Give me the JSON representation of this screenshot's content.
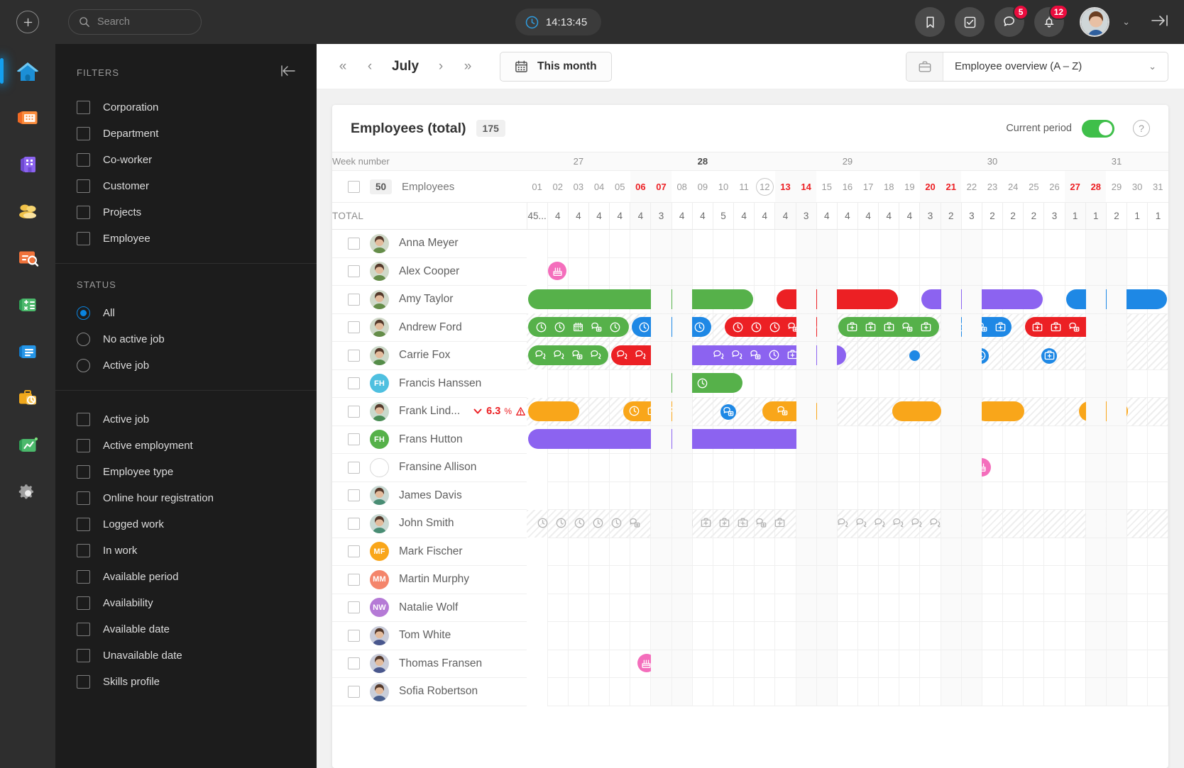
{
  "topbar": {
    "add_label": "+",
    "search_placeholder": "Search",
    "search_value": "",
    "clock_time": "14:13:45",
    "chat_badge": "5",
    "notification_badge": "12"
  },
  "rail": {
    "items": [
      {
        "name": "home",
        "label": "Home"
      },
      {
        "name": "planning",
        "label": "Planning"
      },
      {
        "name": "corporation",
        "label": "Corporation"
      },
      {
        "name": "co-workers",
        "label": "Co-workers"
      },
      {
        "name": "recruitment",
        "label": "Recruitment"
      },
      {
        "name": "calculation",
        "label": "Calculation"
      },
      {
        "name": "documents",
        "label": "Documents"
      },
      {
        "name": "time-registration",
        "label": "Time registration"
      },
      {
        "name": "analytics",
        "label": "Analytics"
      },
      {
        "name": "settings",
        "label": "Settings"
      }
    ]
  },
  "filters": {
    "title": "FILTERS",
    "checkboxes": [
      {
        "label": "Corporation",
        "checked": false
      },
      {
        "label": "Department",
        "checked": false
      },
      {
        "label": "Co-worker",
        "checked": false
      },
      {
        "label": "Customer",
        "checked": false
      },
      {
        "label": "Projects",
        "checked": false
      },
      {
        "label": "Employee",
        "checked": false
      }
    ],
    "status_title": "STATUS",
    "status_options": [
      {
        "label": "All",
        "selected": true
      },
      {
        "label": "No active job",
        "selected": false
      },
      {
        "label": "Active job",
        "selected": false
      }
    ],
    "more_checkboxes": [
      {
        "label": "Active job",
        "checked": false
      },
      {
        "label": "Active employment",
        "checked": false
      },
      {
        "label": "Employee type",
        "checked": false
      },
      {
        "label": "Online hour registration",
        "checked": false
      },
      {
        "label": "Logged work",
        "checked": false
      },
      {
        "label": "In work",
        "checked": false
      },
      {
        "label": "Available period",
        "checked": false
      },
      {
        "label": "Availability",
        "checked": false
      },
      {
        "label": "Available date",
        "checked": false
      },
      {
        "label": "Unavailable date",
        "checked": false
      },
      {
        "label": "Skills profile",
        "checked": false
      }
    ]
  },
  "toolbar": {
    "month": "July",
    "this_month_label": "This month",
    "view_select_value": "Employee overview (A – Z)"
  },
  "card": {
    "title": "Employees (total)",
    "count": "175",
    "current_period_label": "Current period",
    "current_period_on": true,
    "week_number_label": "Week number",
    "employees_count": "50",
    "employees_label": "Employees",
    "total_label": "TOTAL"
  },
  "calendar": {
    "weeks": [
      {
        "number": "27",
        "span": 5,
        "current": false
      },
      {
        "number": "28",
        "span": 7,
        "current": true
      },
      {
        "number": "29",
        "span": 7,
        "current": false
      },
      {
        "number": "30",
        "span": 7,
        "current": false
      },
      {
        "number": "31",
        "span": 5,
        "current": false
      }
    ],
    "days": [
      {
        "n": "01",
        "weekend": false,
        "today": false
      },
      {
        "n": "02",
        "weekend": false,
        "today": false
      },
      {
        "n": "03",
        "weekend": false,
        "today": false
      },
      {
        "n": "04",
        "weekend": false,
        "today": false
      },
      {
        "n": "05",
        "weekend": false,
        "today": false
      },
      {
        "n": "06",
        "weekend": true,
        "today": false
      },
      {
        "n": "07",
        "weekend": true,
        "today": false
      },
      {
        "n": "08",
        "weekend": false,
        "today": false
      },
      {
        "n": "09",
        "weekend": false,
        "today": false
      },
      {
        "n": "10",
        "weekend": false,
        "today": false
      },
      {
        "n": "11",
        "weekend": false,
        "today": false
      },
      {
        "n": "12",
        "weekend": false,
        "today": true
      },
      {
        "n": "13",
        "weekend": true,
        "today": false
      },
      {
        "n": "14",
        "weekend": true,
        "today": false
      },
      {
        "n": "15",
        "weekend": false,
        "today": false
      },
      {
        "n": "16",
        "weekend": false,
        "today": false
      },
      {
        "n": "17",
        "weekend": false,
        "today": false
      },
      {
        "n": "18",
        "weekend": false,
        "today": false
      },
      {
        "n": "19",
        "weekend": false,
        "today": false
      },
      {
        "n": "20",
        "weekend": true,
        "today": false
      },
      {
        "n": "21",
        "weekend": true,
        "today": false
      },
      {
        "n": "22",
        "weekend": false,
        "today": false
      },
      {
        "n": "23",
        "weekend": false,
        "today": false
      },
      {
        "n": "24",
        "weekend": false,
        "today": false
      },
      {
        "n": "25",
        "weekend": false,
        "today": false
      },
      {
        "n": "26",
        "weekend": false,
        "today": false
      },
      {
        "n": "27",
        "weekend": true,
        "today": false
      },
      {
        "n": "28",
        "weekend": true,
        "today": false
      },
      {
        "n": "29",
        "weekend": false,
        "today": false
      },
      {
        "n": "30",
        "weekend": false,
        "today": false
      },
      {
        "n": "31",
        "weekend": false,
        "today": false
      }
    ],
    "totals": [
      "45...",
      "4",
      "4",
      "4",
      "4",
      "4",
      "3",
      "4",
      "4",
      "5",
      "4",
      "4",
      "4",
      "3",
      "4",
      "4",
      "4",
      "4",
      "4",
      "3",
      "2",
      "3",
      "2",
      "2",
      "2",
      "3",
      "1",
      "1",
      "2",
      "1",
      "1"
    ]
  },
  "colors": {
    "green": "#56b14a",
    "red": "#ec2024",
    "purple": "#8c63f0",
    "blue": "#1e88e5",
    "orange": "#f9a61a",
    "pink": "#f46ebc",
    "teal": "#4fc0e0"
  },
  "employees": [
    {
      "name": "Anna Meyer",
      "avatar_type": "photo",
      "photo": "woman1",
      "bars": []
    },
    {
      "name": "Alex Cooper",
      "avatar_type": "photo",
      "photo": "man1",
      "bars": [
        {
          "kind": "pinkdot",
          "start": 1,
          "icon": "birthday-cake"
        }
      ]
    },
    {
      "name": "Amy Taylor",
      "avatar_type": "photo",
      "photo": "woman2",
      "bars": [
        {
          "kind": "bar",
          "color": "green",
          "start": 0,
          "end": 11,
          "icons": []
        },
        {
          "kind": "bar",
          "color": "red",
          "start": 12,
          "end": 18,
          "icons": []
        },
        {
          "kind": "bar",
          "color": "purple",
          "start": 19,
          "end": 25,
          "icons": []
        },
        {
          "kind": "bar",
          "color": "blue",
          "start": 26,
          "end": 31,
          "icons": []
        }
      ]
    },
    {
      "name": "Andrew Ford",
      "avatar_type": "photo",
      "photo": "man2",
      "hatched": true,
      "bars": [
        {
          "kind": "bar",
          "color": "green",
          "start": 0,
          "end": 5,
          "icons": [
            "clock",
            "clock",
            "calendar",
            "chat-tag",
            "clock"
          ]
        },
        {
          "kind": "bar",
          "color": "blue",
          "start": 5,
          "end": 9,
          "icons": [
            "clock",
            "calendar",
            "chat-tag",
            "clock"
          ]
        },
        {
          "kind": "bar",
          "color": "red",
          "start": 9.5,
          "end": 14.5,
          "icons": [
            "clock",
            "clock",
            "clock",
            "chat-tag",
            "clock"
          ]
        },
        {
          "kind": "bar",
          "color": "green",
          "start": 15,
          "end": 20,
          "icons": [
            "kit",
            "kit",
            "kit",
            "chat-tag",
            "kit"
          ]
        },
        {
          "kind": "bar",
          "color": "blue",
          "start": 20.5,
          "end": 23.5,
          "icons": [
            "kit",
            "chat-tag",
            "kit"
          ]
        },
        {
          "kind": "bar",
          "color": "red",
          "start": 24,
          "end": 28,
          "icons": [
            "kit",
            "kit",
            "chat-tag",
            "kit"
          ]
        }
      ]
    },
    {
      "name": "Carrie Fox",
      "avatar_type": "photo",
      "photo": "woman3",
      "hatched": true,
      "bars": [
        {
          "kind": "bar",
          "color": "green",
          "start": 0,
          "end": 4,
          "icons": [
            "chat",
            "chat",
            "chat-tag",
            "chat"
          ]
        },
        {
          "kind": "bar",
          "color": "red",
          "start": 4,
          "end": 7,
          "icons": [
            "chat",
            "chat",
            "calendar"
          ]
        },
        {
          "kind": "bar",
          "color": "purple",
          "start": 7.5,
          "end": 15.5,
          "icons": [
            "chat",
            "chat",
            "chat-tag",
            "clock",
            "kit",
            "calendar"
          ]
        },
        {
          "kind": "dot",
          "color": "blue",
          "start": 18.3
        },
        {
          "kind": "ring",
          "color": "blue",
          "start": 21.5,
          "icon": "clock"
        },
        {
          "kind": "ring",
          "color": "blue",
          "start": 24.8,
          "icon": "kit"
        }
      ]
    },
    {
      "name": "Francis Hanssen",
      "avatar_type": "initials",
      "initials": "FH",
      "color": "teal",
      "bars": [
        {
          "kind": "bar",
          "color": "green",
          "start": 6.5,
          "end": 10.5,
          "icons": [
            "clock"
          ]
        }
      ]
    },
    {
      "name": "Frank Lind...",
      "avatar_type": "photo",
      "photo": "man3",
      "hatched": true,
      "percent": "6.3",
      "percent_unit": "%",
      "warning": true,
      "bars": [
        {
          "kind": "bar",
          "color": "orange",
          "start": 0,
          "end": 2.6,
          "icons": []
        },
        {
          "kind": "bar",
          "color": "orange",
          "start": 4.6,
          "end": 7.6,
          "icons": [
            "clock",
            "kit",
            "chat"
          ]
        },
        {
          "kind": "ring",
          "color": "blue",
          "start": 9.3,
          "icon": "chat-tag"
        },
        {
          "kind": "bar",
          "color": "orange",
          "start": 11.3,
          "end": 14.3,
          "icons": [
            "chat-tag",
            "calendar"
          ]
        },
        {
          "kind": "bar",
          "color": "orange",
          "start": 17.6,
          "end": 20.1,
          "icons": []
        },
        {
          "kind": "bar",
          "color": "orange",
          "start": 21.6,
          "end": 24.1,
          "icons": []
        },
        {
          "kind": "bar",
          "color": "orange",
          "start": 26.6,
          "end": 29.1,
          "icons": []
        }
      ]
    },
    {
      "name": "Frans Hutton",
      "avatar_type": "initials",
      "initials": "FH",
      "color": "green",
      "bars": [
        {
          "kind": "bar",
          "color": "purple",
          "start": 0,
          "end": 14,
          "icons": []
        }
      ]
    },
    {
      "name": "Fransine Allison",
      "avatar_type": "empty",
      "bars": [
        {
          "kind": "pinkdot",
          "start": 21.5,
          "icon": "birthday-cake"
        }
      ]
    },
    {
      "name": "James Davis",
      "avatar_type": "photo",
      "photo": "man4",
      "bars": []
    },
    {
      "name": "John Smith",
      "avatar_type": "photo",
      "photo": "man5",
      "hatched": true,
      "bars": [
        {
          "kind": "icons",
          "color": "gray",
          "start": 0,
          "icons": [
            "clock",
            "clock",
            "clock",
            "clock",
            "clock",
            "chat-tag"
          ]
        },
        {
          "kind": "icons",
          "color": "gray",
          "start": 7,
          "icons": [
            "kit",
            "kit",
            "kit",
            "kit",
            "chat-tag",
            "kit"
          ]
        },
        {
          "kind": "icons",
          "color": "gray",
          "start": 14.5,
          "icons": [
            "chat",
            "chat",
            "chat",
            "chat",
            "chat",
            "chat"
          ]
        }
      ]
    },
    {
      "name": "Mark Fischer",
      "avatar_type": "initials",
      "initials": "MF",
      "color": "orange",
      "bars": []
    },
    {
      "name": "Martin Murphy",
      "avatar_type": "initials",
      "initials": "MM",
      "color": "salmon",
      "bars": []
    },
    {
      "name": "Natalie Wolf",
      "avatar_type": "initials",
      "initials": "NW",
      "color": "violet",
      "bars": []
    },
    {
      "name": "Tom White",
      "avatar_type": "photo",
      "photo": "man6",
      "bars": []
    },
    {
      "name": "Thomas Fransen",
      "avatar_type": "photo",
      "photo": "man7",
      "bars": [
        {
          "kind": "pinkdot",
          "start": 5.3,
          "icon": "birthday-cake"
        }
      ]
    },
    {
      "name": "Sofia Robertson",
      "avatar_type": "photo",
      "photo": "woman4",
      "bars": []
    }
  ]
}
